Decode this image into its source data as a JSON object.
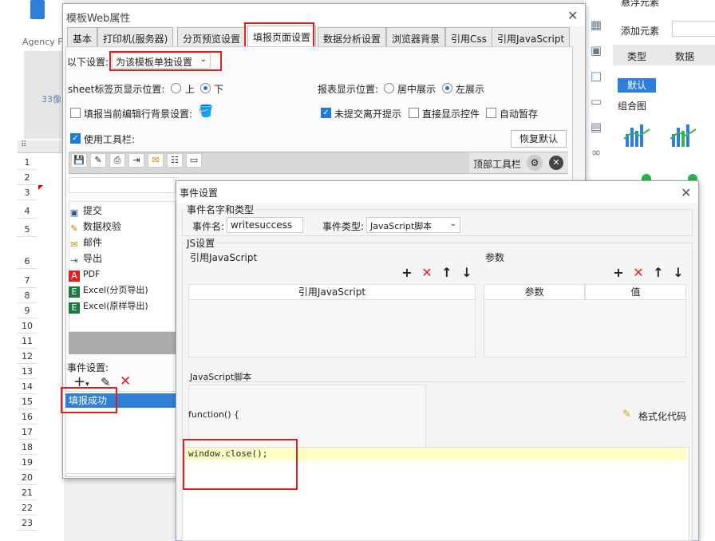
{
  "background": {
    "agency_label": "Agency F",
    "ruler_text": "33像",
    "row_numbers": [
      "1",
      "2",
      "3",
      "4",
      "5",
      "6",
      "7",
      "8",
      "9",
      "10",
      "11",
      "12",
      "13",
      "14",
      "15",
      "16",
      "17",
      "18",
      "19",
      "20",
      "21",
      "22",
      "23"
    ],
    "right_panel": {
      "top_text": "悬浮元素",
      "add_element": "添加元素",
      "tab_type": "类型",
      "tab_data": "数据",
      "default_button": "默认",
      "combo_chart": "组合图"
    }
  },
  "main_dialog": {
    "title": "模板Web属性",
    "tabs": [
      "基本",
      "打印机(服务器)",
      "分页预览设置",
      "填报页面设置",
      "数据分析设置",
      "浏览器背景",
      "引用Css",
      "引用JavaScript"
    ],
    "active_tab": "填报页面设置",
    "settings_label": "以下设置:",
    "settings_value": "为该模板单独设置",
    "sheet_tab_position_label": "sheet标签页显示位置:",
    "sheet_tab_options": [
      "上",
      "下"
    ],
    "sheet_tab_selected": "下",
    "report_position_label": "报表显示位置:",
    "report_position_options": [
      "居中展示",
      "左展示"
    ],
    "report_position_selected": "左展示",
    "fill_bg_label": "填报当前编辑行背景设置:",
    "unsubmitted_prompt": "未提交离开提示",
    "direct_show_control": "直接显示控件",
    "auto_save": "自动暂存",
    "use_toolbar": "使用工具栏:",
    "restore_default": "恢复默认",
    "top_toolbar": "顶部工具栏",
    "toolbar_items": [
      {
        "icon": "save-icon",
        "label": "提交"
      },
      {
        "icon": "verify-icon",
        "label": "数据校验"
      },
      {
        "icon": "mail-icon",
        "label": "邮件"
      },
      {
        "icon": "export-icon",
        "label": "导出"
      },
      {
        "icon": "pdf-icon",
        "label": "PDF"
      },
      {
        "icon": "excel-icon",
        "label": "Excel(分页导出)"
      },
      {
        "icon": "excel-icon",
        "label": "Excel(原样导出)"
      }
    ],
    "event_settings_label": "事件设置:",
    "event_item": "填报成功"
  },
  "event_dialog": {
    "title": "事件设置",
    "name_type_group": "事件名字和类型",
    "event_name_label": "事件名:",
    "event_name_value": "writesuccess",
    "event_type_label": "事件类型:",
    "event_type_value": "JavaScript脚本",
    "js_settings_group": "JS设置",
    "ref_js_label": "引用JavaScript",
    "params_label": "参数",
    "ref_js_column": "引用JavaScript",
    "param_columns": [
      "参数",
      "值"
    ],
    "js_script_label": "JavaScript脚本",
    "function_header": "function() {",
    "format_code": "格式化代码",
    "code_line": "window.close();"
  },
  "colors": {
    "accent_blue": "#1e7bd6",
    "highlight_red": "#e02020",
    "selection_blue": "#2f7fd8",
    "code_highlight": "#ffffc8"
  }
}
